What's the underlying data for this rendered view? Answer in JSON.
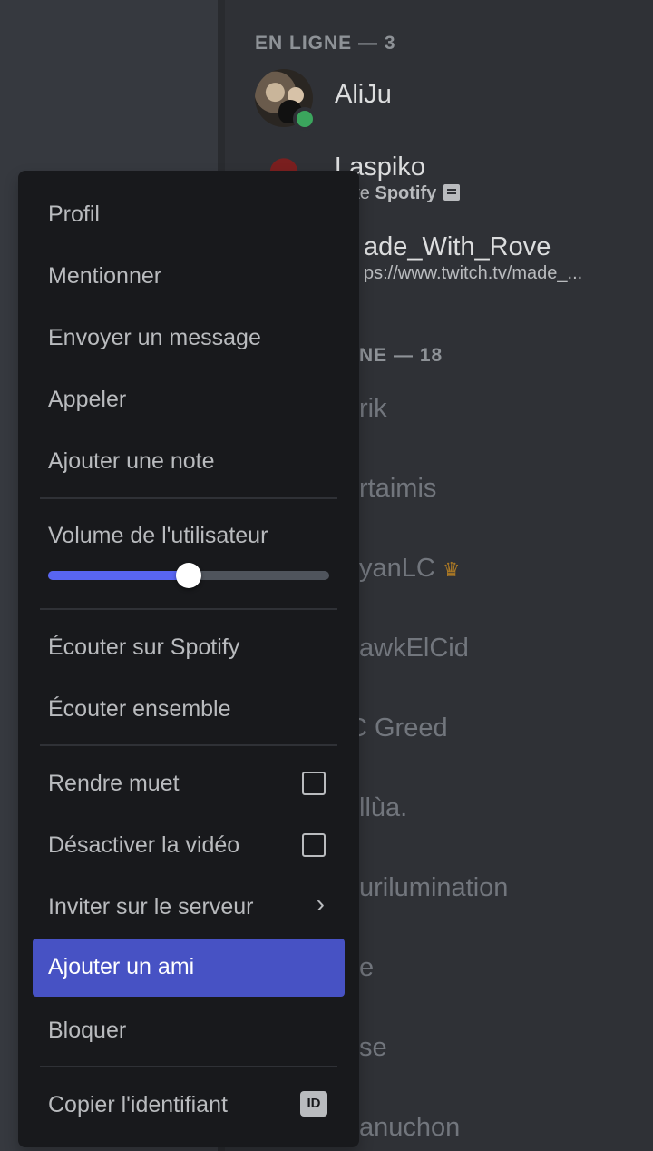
{
  "members": {
    "online_header": "EN LIGNE — 3",
    "online": [
      {
        "name": "AliJu",
        "status": "online"
      },
      {
        "name": "Laspiko",
        "activity_prefix": "oute",
        "activity_app": "Spotify"
      },
      {
        "name": "ade_With_Rove",
        "activity": "ps://www.twitch.tv/made_..."
      }
    ],
    "offline_header": "NE — 18",
    "offline": [
      "rik",
      "rtaimis",
      "yanLC",
      "awkElCid",
      "C Greed",
      "llùa.",
      "urilumination",
      "e",
      "se",
      "anuchon"
    ]
  },
  "menu": {
    "items": {
      "profile": "Profil",
      "mention": "Mentionner",
      "message": "Envoyer un message",
      "call": "Appeler",
      "note": "Ajouter une note",
      "volume": "Volume de l'utilisateur",
      "listen_spotify": "Écouter sur Spotify",
      "listen_together": "Écouter ensemble",
      "mute": "Rendre muet",
      "disable_video": "Désactiver la vidéo",
      "invite": "Inviter sur le serveur",
      "add_friend": "Ajouter un ami",
      "block": "Bloquer",
      "copy_id": "Copier l'identifiant",
      "id_badge": "ID"
    },
    "volume_level": 0.5,
    "mute_checked": false,
    "video_checked": false
  },
  "colors": {
    "accent": "#5865f2",
    "active_item": "#4752c4",
    "online": "#3ba55d",
    "menu_bg": "#18191c"
  }
}
